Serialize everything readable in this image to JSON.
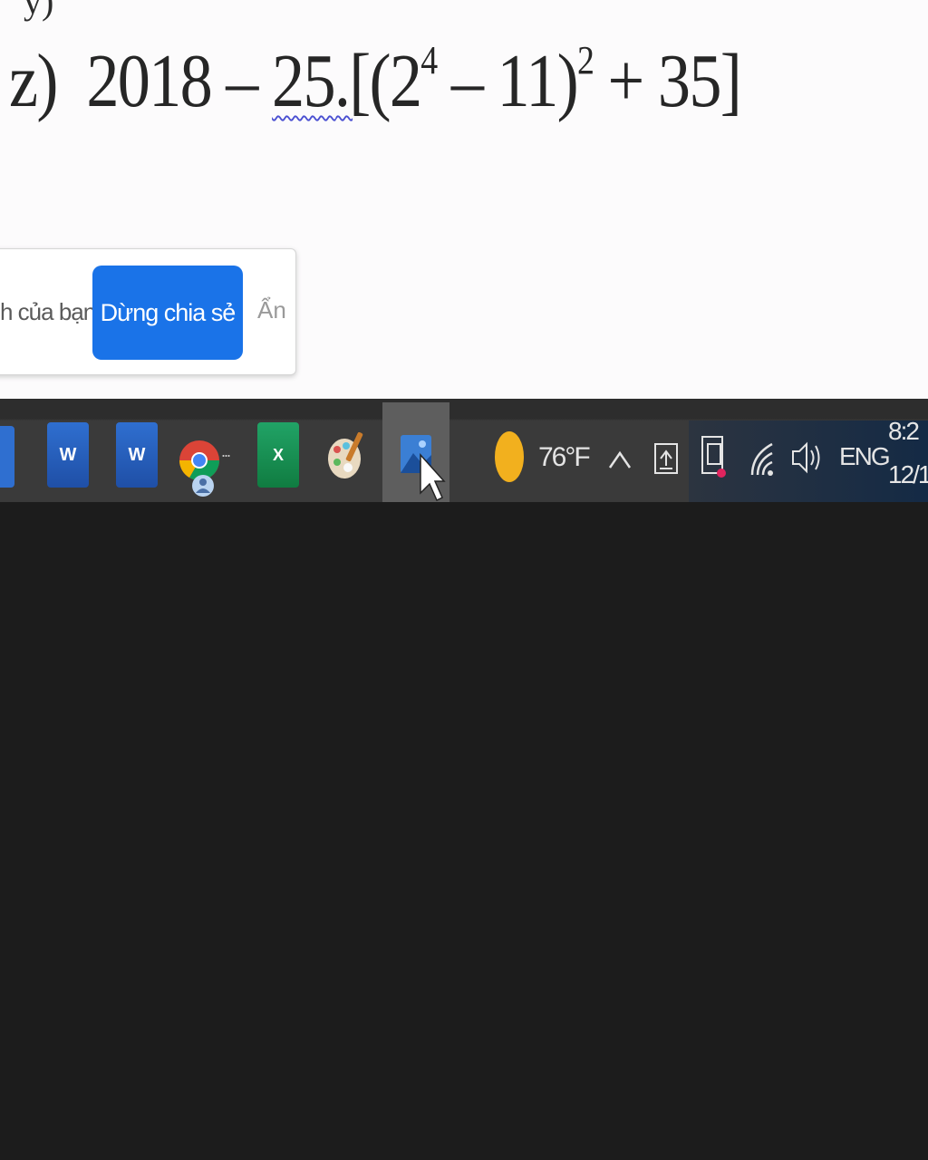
{
  "document": {
    "top_fragment": "y)",
    "equation": {
      "label": "z)",
      "text_before": "2018 – ",
      "spell_marked": "25.[",
      "open_paren": "(2",
      "exp1": "4",
      "middle": " – 11)",
      "exp2": "2",
      "tail": " + 35]"
    }
  },
  "share_bar": {
    "message": "h của bạn.",
    "stop_button": "Dừng chia sẻ",
    "hide_link": "Ẩn"
  },
  "taskbar": {
    "icons": [
      {
        "name": "word-icon",
        "glyph": "W"
      },
      {
        "name": "word-icon",
        "glyph": "W"
      },
      {
        "name": "chrome-icon"
      },
      {
        "name": "excel-icon",
        "glyph": "X"
      },
      {
        "name": "paint-icon"
      },
      {
        "name": "photos-icon"
      }
    ],
    "chrome_overflow": "...",
    "colors": {
      "accent_blue": "#1a73e8",
      "taskbar_bg": "#3a3a3a",
      "active_tile": "#5e5e5e"
    }
  },
  "tray": {
    "temperature": "76°F",
    "language": "ENG",
    "time": "8:2",
    "date": "12/1"
  }
}
